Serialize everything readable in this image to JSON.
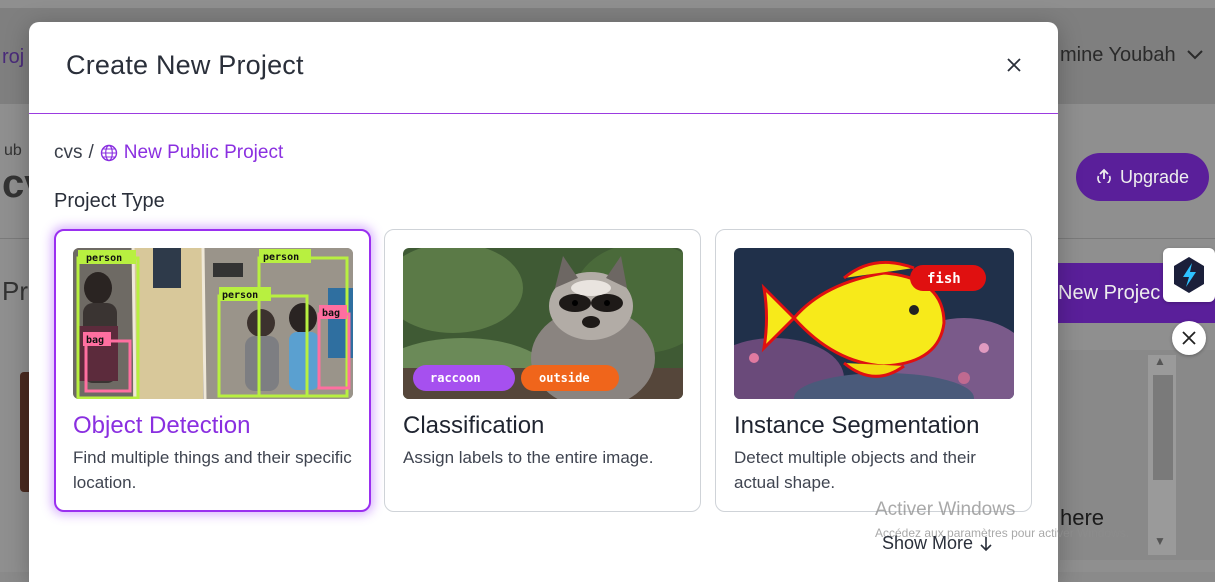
{
  "background": {
    "top_left_fragment": "roj",
    "user_name_fragment": "mine Youbah",
    "left_small_fragment": "ub",
    "left_big_fragment": "cv",
    "left_section_fragment": "Pr",
    "upgrade_label": "Upgrade",
    "new_project_label": "New Projec",
    "panel_text_fragment": "here"
  },
  "modal": {
    "title": "Create New Project",
    "breadcrumb": {
      "workspace": "cvs",
      "separator": "/",
      "project_name": "New Public Project"
    },
    "section_label": "Project Type",
    "cards": [
      {
        "title": "Object Detection",
        "description": "Find multiple things and their specific location.",
        "selected": true,
        "image_labels": [
          "person",
          "person",
          "person",
          "bag",
          "bag"
        ]
      },
      {
        "title": "Classification",
        "description": "Assign labels to the entire image.",
        "selected": false,
        "image_labels": [
          "raccoon",
          "outside"
        ]
      },
      {
        "title": "Instance Segmentation",
        "description": "Detect multiple objects and their actual shape.",
        "selected": false,
        "image_labels": [
          "fish"
        ]
      }
    ],
    "show_more_label": "Show More"
  },
  "watermark": {
    "title": "Activer Windows",
    "subtitle": "Accédez aux paramètres pour activer Windows."
  },
  "colors": {
    "accent": "#8a2fe0",
    "header_rule": "#9b3be0",
    "bg_button": "#5a1f9a"
  }
}
